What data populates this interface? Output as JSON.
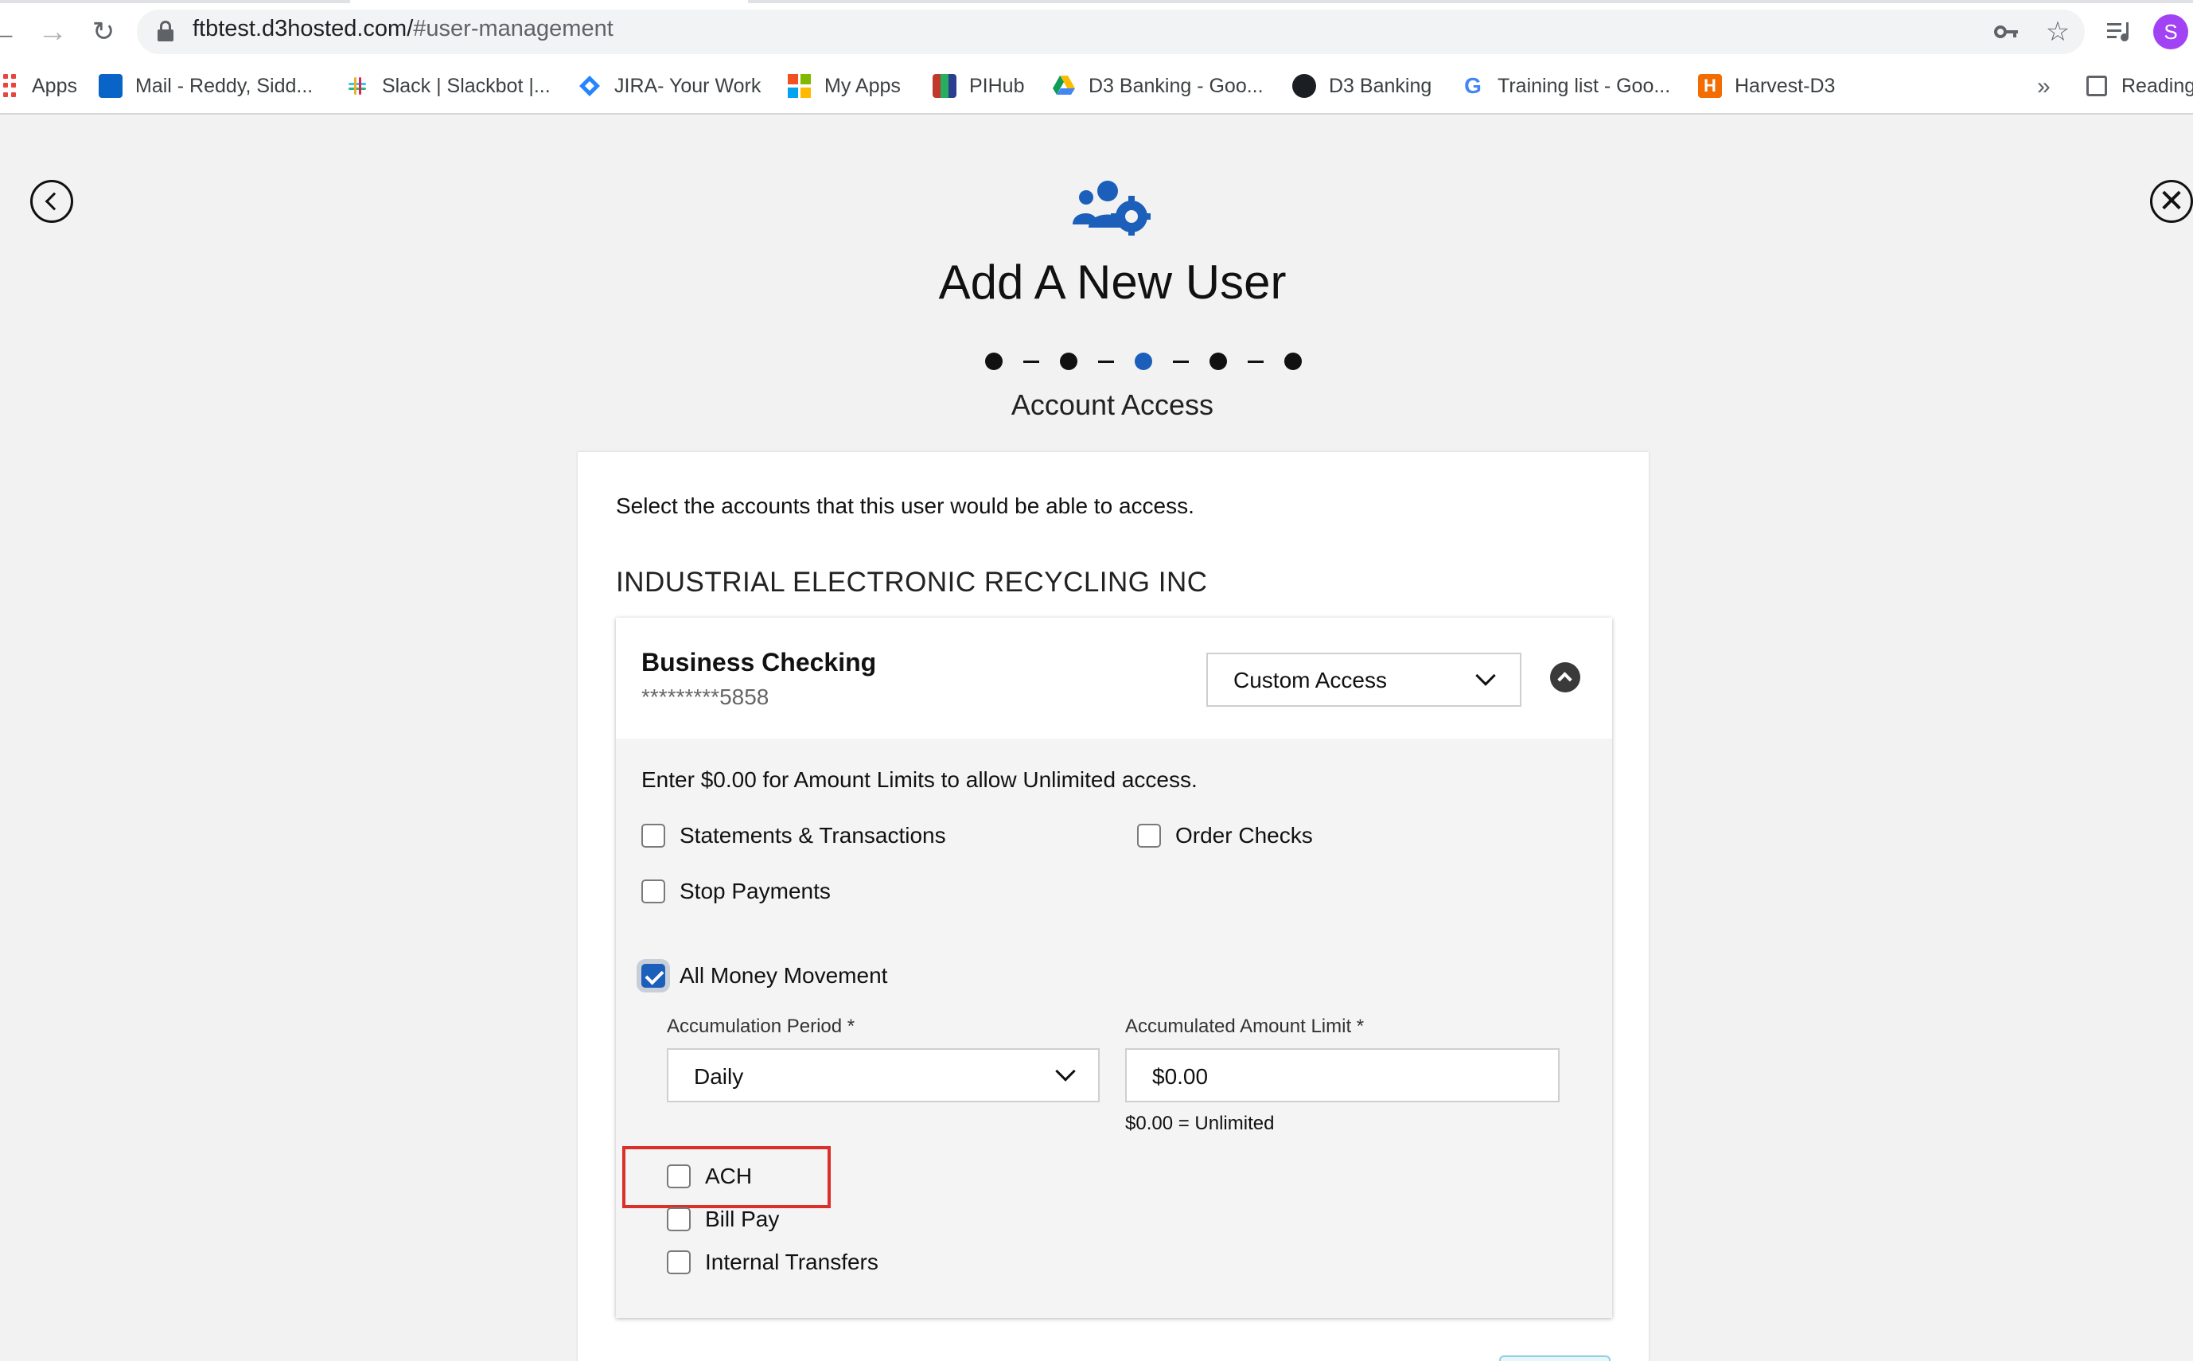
{
  "browser": {
    "url_host": "ftbtest.d3hosted.com/",
    "url_path": "#user-management",
    "profile_initial": "S",
    "bookmarks": [
      {
        "label": "Apps"
      },
      {
        "label": "Mail - Reddy, Sidd..."
      },
      {
        "label": "Slack | Slackbot |..."
      },
      {
        "label": "JIRA- Your Work"
      },
      {
        "label": "My Apps"
      },
      {
        "label": "PIHub"
      },
      {
        "label": "D3 Banking - Goo..."
      },
      {
        "label": "D3 Banking"
      },
      {
        "label": "Training list - Goo..."
      },
      {
        "label": "Harvest-D3"
      }
    ],
    "more_label": "»",
    "reading_list_label": "Reading"
  },
  "page": {
    "title": "Add A New User",
    "steps": {
      "count": 5,
      "current": 3
    },
    "step_label": "Account Access",
    "intro": "Select the accounts that this user would be able to access.",
    "company": "INDUSTRIAL ELECTRONIC RECYCLING INC"
  },
  "account": {
    "name": "Business Checking",
    "number": "*********5858",
    "access_level": "Custom Access",
    "hint": "Enter $0.00 for Amount Limits to allow Unlimited access.",
    "permissions": {
      "statements": {
        "label": "Statements & Transactions",
        "checked": false
      },
      "order_checks": {
        "label": "Order Checks",
        "checked": false
      },
      "stop_payments": {
        "label": "Stop Payments",
        "checked": false
      },
      "money_movement": {
        "label": "All Money Movement",
        "checked": true
      }
    },
    "accumulation_period": {
      "label": "Accumulation Period *",
      "value": "Daily"
    },
    "amount_limit": {
      "label": "Accumulated Amount Limit *",
      "value": "$0.00",
      "help": "$0.00 = Unlimited"
    },
    "sub_permissions": {
      "ach": {
        "label": "ACH",
        "checked": false
      },
      "bill_pay": {
        "label": "Bill Pay",
        "checked": false
      },
      "internal_transfers": {
        "label": "Internal Transfers",
        "checked": false
      }
    }
  },
  "colors": {
    "accent": "#1b5fba",
    "highlight": "#d9302a"
  }
}
